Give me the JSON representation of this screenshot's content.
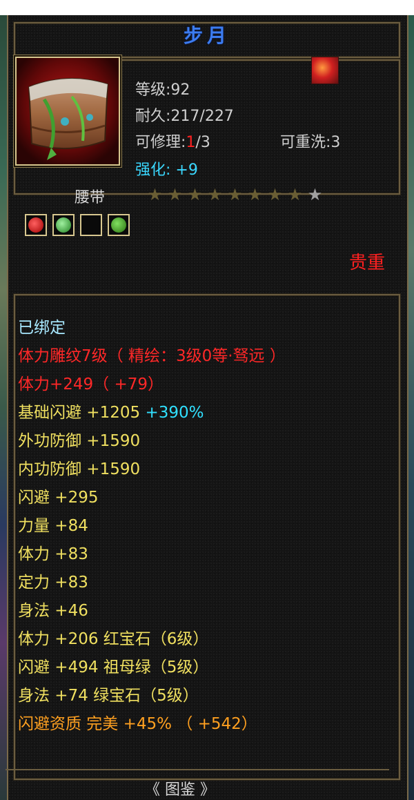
{
  "item": {
    "title": "步月",
    "level": "等级:92",
    "durability": "耐久:217/227",
    "repair_prefix": "可修理:",
    "repair_value": "1",
    "repair_suffix": "/3",
    "rewash": "可重洗:3",
    "enhance_label": "强化:",
    "enhance_value": "+9",
    "type_name": "腰带",
    "stars_filled": 8,
    "stars_total": 9,
    "quality": "贵重"
  },
  "attributes": {
    "bound": "已绑定",
    "engrave": "体力雕纹7级（ 精绘：3级0等·驽远 ）",
    "stamina_bonus": "体力+249（ +79）",
    "base_dodge_label": "基础闪避  +1205 ",
    "base_dodge_pct": "+390%",
    "outer_def": "外功防御  +1590",
    "inner_def": "内功防御  +1590",
    "dodge": "闪避  +295",
    "strength": "力量  +84",
    "stamina": "体力  +83",
    "focus": "定力  +83",
    "agility": "身法  +46",
    "gem1": "体力  +206  红宝石（6级）",
    "gem2": "闪避  +494  祖母绿（5级）",
    "gem3": "身法  +74  绿宝石（5级）",
    "aptitude": "闪避资质   完美  +45%  （ +542）"
  },
  "footer": {
    "text": "《   图鉴 》"
  },
  "colors": {
    "title": "#3c7cf0",
    "frame": "#6b5d40",
    "red": "#ff2020",
    "yellow": "#f0e060",
    "orange": "#ffa020",
    "cyan": "#30e0ff"
  },
  "icons": {
    "item": "belt-icon",
    "quality": "quality-flame-icon",
    "gems": [
      "red-gem-icon",
      "green-gem-icon",
      "empty-gem-slot",
      "emerald-gem-icon"
    ]
  }
}
